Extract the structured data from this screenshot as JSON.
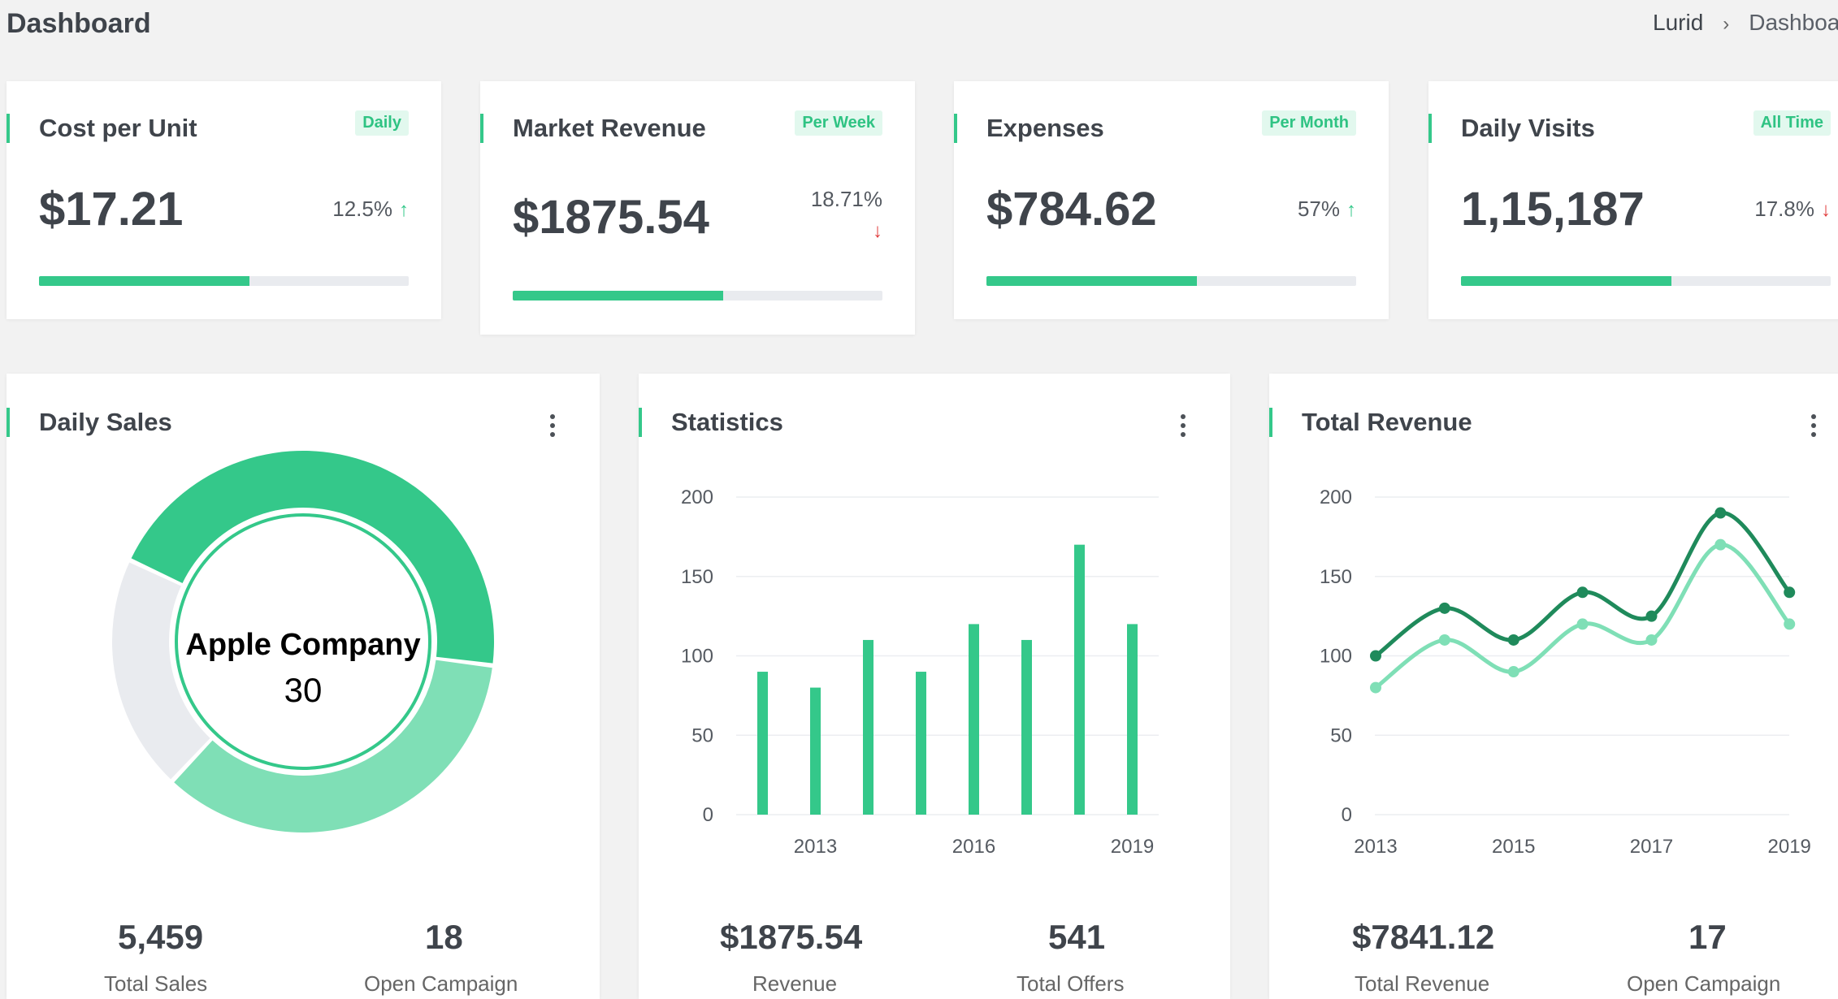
{
  "page": {
    "title": "Dashboard"
  },
  "breadcrumb": [
    "Lurid",
    "Dashboard"
  ],
  "stat_cards": [
    {
      "title": "Cost per Unit",
      "badge": "Daily",
      "value": "$17.21",
      "change": "12.5%",
      "trend": "up",
      "progress": 0.57
    },
    {
      "title": "Market Revenue",
      "badge": "Per Week",
      "value": "$1875.54",
      "change": "18.71%",
      "trend": "down",
      "progress": 0.57
    },
    {
      "title": "Expenses",
      "badge": "Per Month",
      "value": "$784.62",
      "change": "57%",
      "trend": "up",
      "progress": 0.57
    },
    {
      "title": "Daily Visits",
      "badge": "All Time",
      "value": "1,15,187",
      "change": "17.8%",
      "trend": "down",
      "progress": 0.57
    }
  ],
  "daily_sales": {
    "title": "Daily Sales",
    "center_label": "Apple Company",
    "center_value": "30",
    "footer": [
      {
        "value": "5,459",
        "label": "Total Sales"
      },
      {
        "value": "18",
        "label": "Open Campaign"
      }
    ]
  },
  "statistics": {
    "title": "Statistics",
    "footer": [
      {
        "value": "$1875.54",
        "label": "Revenue"
      },
      {
        "value": "541",
        "label": "Total Offers"
      }
    ]
  },
  "total_revenue": {
    "title": "Total Revenue",
    "footer": [
      {
        "value": "$7841.12",
        "label": "Total Revenue"
      },
      {
        "value": "17",
        "label": "Open Campaign"
      }
    ]
  },
  "colors": {
    "accent": "#34c88a",
    "accent_light": "#7fdfb6",
    "accent_dark": "#1f8a5b",
    "muted": "#e9ebef",
    "down": "#e03b3b"
  },
  "chart_data": [
    {
      "type": "pie",
      "title": "Daily Sales",
      "variant": "donut",
      "categories": [
        "",
        "",
        ""
      ],
      "values": [
        45,
        35,
        20
      ],
      "colors": [
        "#34c88a",
        "#7fdfb6",
        "#e9ebef"
      ]
    },
    {
      "type": "bar",
      "title": "Statistics",
      "x": [
        2012,
        2013,
        2014,
        2015,
        2016,
        2017,
        2018,
        2019
      ],
      "x_tick_labels": [
        "2013",
        "2016",
        "2019"
      ],
      "values": [
        90,
        80,
        110,
        90,
        120,
        110,
        170,
        120
      ],
      "ylim": [
        0,
        200
      ],
      "y_ticks": [
        "0",
        "50",
        "100",
        "150",
        "200"
      ],
      "grid": true
    },
    {
      "type": "line",
      "title": "Total Revenue",
      "x": [
        2013,
        2014,
        2015,
        2016,
        2017,
        2018,
        2019
      ],
      "x_tick_labels": [
        "2013",
        "2015",
        "2017",
        "2019"
      ],
      "series": [
        {
          "values": [
            100,
            130,
            110,
            140,
            125,
            190,
            140
          ],
          "color": "#1f8a5b"
        },
        {
          "values": [
            80,
            110,
            90,
            120,
            110,
            170,
            120
          ],
          "color": "#7fdfb6"
        }
      ],
      "ylim": [
        0,
        200
      ],
      "y_ticks": [
        "0",
        "50",
        "100",
        "150",
        "200"
      ],
      "grid": true,
      "smooth": true
    }
  ]
}
